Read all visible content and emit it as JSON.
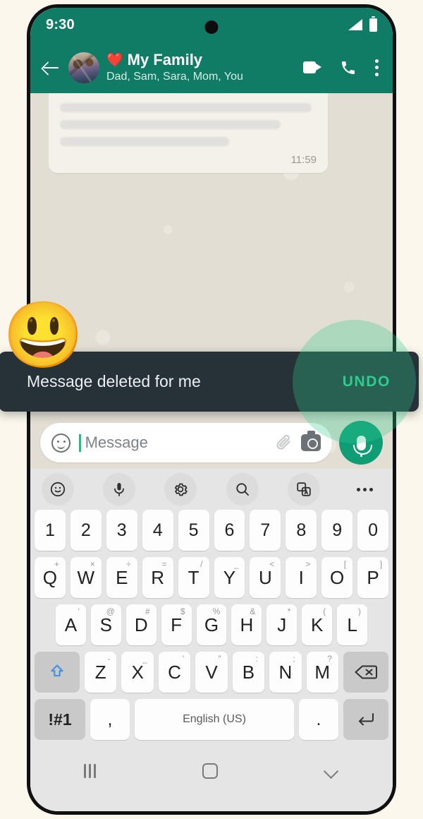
{
  "status_bar": {
    "time": "9:30",
    "signal_icon": "signal-bars-icon",
    "battery_icon": "battery-icon"
  },
  "chat_header": {
    "back_icon": "back-arrow-icon",
    "avatar": "group-avatar",
    "heart": "❤️",
    "title": "My Family",
    "subtitle": "Dad, Sam, Sara, Mom, You",
    "video_call_icon": "video-call-icon",
    "voice_call_icon": "phone-call-icon",
    "overflow_icon": "kebab-menu-icon"
  },
  "conversation": {
    "message_bubble": {
      "redacted_lines": 3,
      "timestamp": "11:59"
    }
  },
  "snackbar": {
    "message": "Message deleted for me",
    "action_label": "UNDO",
    "background_color": "#263138",
    "action_color": "#2ecc8f",
    "emoji_sticker": "😃"
  },
  "input_bar": {
    "emoji_icon": "smiley-icon",
    "placeholder": "Message",
    "attach_icon": "paperclip-icon",
    "camera_icon": "camera-icon",
    "mic_icon": "microphone-icon",
    "mic_button_color": "#0f9d76"
  },
  "keyboard": {
    "toolbar": [
      {
        "name": "emoji-icon"
      },
      {
        "name": "voice-input-icon"
      },
      {
        "name": "gear-icon"
      },
      {
        "name": "search-icon"
      },
      {
        "name": "translate-icon"
      },
      {
        "name": "more-icon"
      }
    ],
    "rows": {
      "numbers": [
        {
          "key": "1"
        },
        {
          "key": "2"
        },
        {
          "key": "3"
        },
        {
          "key": "4"
        },
        {
          "key": "5"
        },
        {
          "key": "6"
        },
        {
          "key": "7"
        },
        {
          "key": "8"
        },
        {
          "key": "9"
        },
        {
          "key": "0"
        }
      ],
      "top": [
        {
          "key": "Q",
          "sup": "+"
        },
        {
          "key": "W",
          "sup": "×"
        },
        {
          "key": "E",
          "sup": "÷"
        },
        {
          "key": "R",
          "sup": "="
        },
        {
          "key": "T",
          "sup": "/"
        },
        {
          "key": "Y",
          "sup": "_"
        },
        {
          "key": "U",
          "sup": "<"
        },
        {
          "key": "I",
          "sup": ">"
        },
        {
          "key": "O",
          "sup": "["
        },
        {
          "key": "P",
          "sup": "]"
        }
      ],
      "home": [
        {
          "key": "A",
          "sup": "'"
        },
        {
          "key": "S",
          "sup": "@"
        },
        {
          "key": "D",
          "sup": "#"
        },
        {
          "key": "F",
          "sup": "$"
        },
        {
          "key": "G",
          "sup": "%"
        },
        {
          "key": "H",
          "sup": "&"
        },
        {
          "key": "J",
          "sup": "*"
        },
        {
          "key": "K",
          "sup": "("
        },
        {
          "key": "L",
          "sup": ")"
        }
      ],
      "bottom": [
        {
          "key": "Z",
          "sup": "-"
        },
        {
          "key": "X",
          "sup": "_"
        },
        {
          "key": "C",
          "sup": "'"
        },
        {
          "key": "V",
          "sup": "\""
        },
        {
          "key": "B",
          "sup": ":"
        },
        {
          "key": "N",
          "sup": ";"
        },
        {
          "key": "M",
          "sup": "?"
        }
      ],
      "shift_icon": "shift-key-icon",
      "backspace_icon": "backspace-key-icon",
      "last": {
        "symbols": "!#1",
        "comma": ",",
        "space": "English (US)",
        "period": ".",
        "enter_icon": "enter-key-icon"
      }
    }
  },
  "nav_bar": {
    "recents_icon": "recents-icon",
    "home_icon": "home-icon",
    "hide_keyboard_icon": "chevron-down-icon"
  }
}
